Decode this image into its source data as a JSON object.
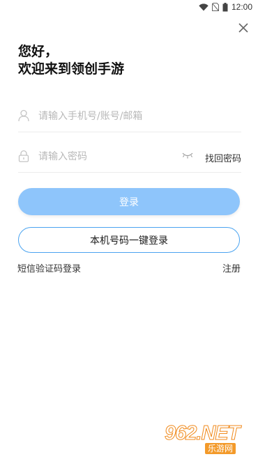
{
  "status_bar": {
    "time": "12:00"
  },
  "header": {
    "line1": "您好，",
    "line2": "欢迎来到领创手游"
  },
  "form": {
    "phone_placeholder": "请输入手机号/账号/邮箱",
    "password_placeholder": "请输入密码",
    "forgot_password": "找回密码"
  },
  "buttons": {
    "login": "登录",
    "one_click_login": "本机号码一键登录"
  },
  "links": {
    "sms_login": "短信验证码登录",
    "register": "注册"
  },
  "watermark": {
    "top": "962.NET",
    "bottom": "乐游网"
  },
  "colors": {
    "primary_button": "#8ec5fb",
    "outline_button_border": "#4aa3f0"
  }
}
